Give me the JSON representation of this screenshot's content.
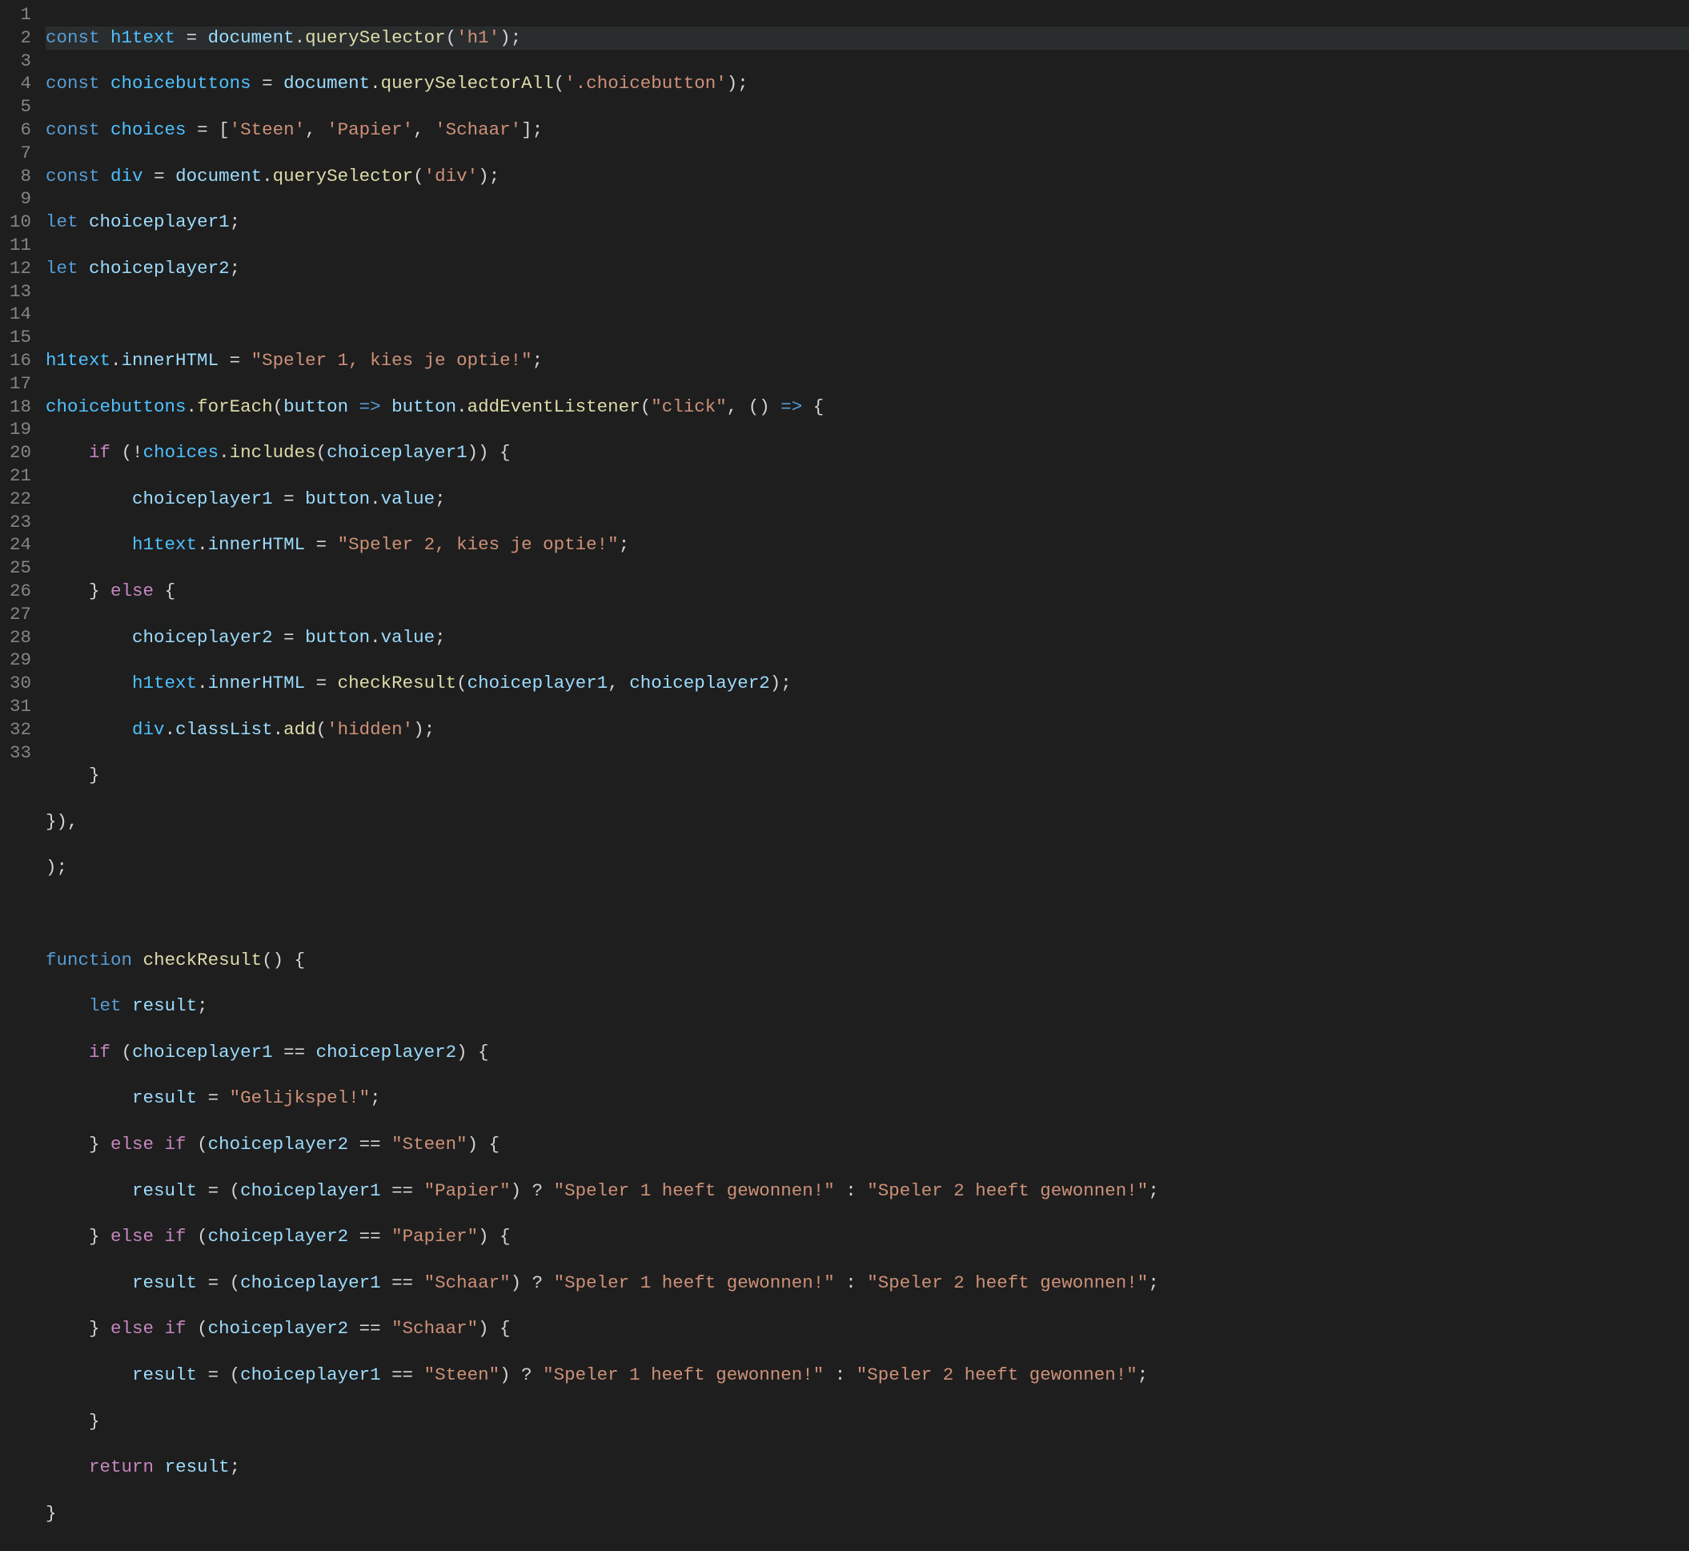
{
  "lineNumbers": [
    "1",
    "2",
    "3",
    "4",
    "5",
    "6",
    "7",
    "8",
    "9",
    "10",
    "11",
    "12",
    "13",
    "14",
    "15",
    "16",
    "17",
    "18",
    "19",
    "20",
    "21",
    "22",
    "23",
    "24",
    "25",
    "26",
    "27",
    "28",
    "29",
    "30",
    "31",
    "32",
    "33"
  ],
  "code": {
    "l1": {
      "kw": "const",
      "name": "h1text",
      "eq": " = ",
      "obj": "document",
      "dot": ".",
      "fn": "querySelector",
      "lp": "(",
      "str": "'h1'",
      "rp": ");"
    },
    "l2": {
      "kw": "const",
      "name": "choicebuttons",
      "eq": " = ",
      "obj": "document",
      "dot": ".",
      "fn": "querySelectorAll",
      "lp": "(",
      "str": "'.choicebutton'",
      "rp": ");"
    },
    "l3": {
      "kw": "const",
      "name": "choices",
      "eq": " = [",
      "s1": "'Steen'",
      "c1": ", ",
      "s2": "'Papier'",
      "c2": ", ",
      "s3": "'Schaar'",
      "end": "];"
    },
    "l4": {
      "kw": "const",
      "name": "div",
      "eq": " = ",
      "obj": "document",
      "dot": ".",
      "fn": "querySelector",
      "lp": "(",
      "str": "'div'",
      "rp": ");"
    },
    "l5": {
      "kw": "let",
      "name": "choiceplayer1",
      "end": ";"
    },
    "l6": {
      "kw": "let",
      "name": "choiceplayer2",
      "end": ";"
    },
    "l8": {
      "obj": "h1text",
      "dot": ".",
      "prop": "innerHTML",
      "eq": " = ",
      "str": "\"Speler 1, kies je optie!\"",
      "end": ";"
    },
    "l9": {
      "obj": "choicebuttons",
      "dot": ".",
      "fn": "forEach",
      "lp": "(",
      "param": "button",
      "arrow": " => ",
      "obj2": "button",
      "dot2": ".",
      "fn2": "addEventListener",
      "lp2": "(",
      "evt": "\"click\"",
      "c": ", () ",
      "arrow2": "=>",
      "brace": " {"
    },
    "l10": {
      "indent": "    ",
      "kw": "if",
      "lp": " (!",
      "obj": "choices",
      "dot": ".",
      "fn": "includes",
      "lp2": "(",
      "arg": "choiceplayer1",
      "rp": ")) {"
    },
    "l11": {
      "indent": "        ",
      "lhs": "choiceplayer1",
      "eq": " = ",
      "obj": "button",
      "dot": ".",
      "prop": "value",
      "end": ";"
    },
    "l12": {
      "indent": "        ",
      "obj": "h1text",
      "dot": ".",
      "prop": "innerHTML",
      "eq": " = ",
      "str": "\"Speler 2, kies je optie!\"",
      "end": ";"
    },
    "l13": {
      "indent": "    ",
      "close": "}",
      "kw": " else ",
      "open": "{"
    },
    "l14": {
      "indent": "        ",
      "lhs": "choiceplayer2",
      "eq": " = ",
      "obj": "button",
      "dot": ".",
      "prop": "value",
      "end": ";"
    },
    "l15": {
      "indent": "        ",
      "obj": "h1text",
      "dot": ".",
      "prop": "innerHTML",
      "eq": " = ",
      "fn": "checkResult",
      "lp": "(",
      "a1": "choiceplayer1",
      "c": ", ",
      "a2": "choiceplayer2",
      "rp": ");"
    },
    "l16": {
      "indent": "        ",
      "obj": "div",
      "dot": ".",
      "prop": "classList",
      "dot2": ".",
      "fn": "add",
      "lp": "(",
      "str": "'hidden'",
      "rp": ");"
    },
    "l17": {
      "indent": "    ",
      "close": "}"
    },
    "l18": {
      "text": "}),"
    },
    "l19": {
      "text": ");"
    },
    "l21": {
      "kw": "function",
      "name": "checkResult",
      "parens": "() {"
    },
    "l22": {
      "indent": "    ",
      "kw": "let",
      "name": "result",
      "end": ";"
    },
    "l23": {
      "indent": "    ",
      "kw": "if",
      "lp": " (",
      "a": "choiceplayer1",
      "op": " == ",
      "b": "choiceplayer2",
      "rp": ") {"
    },
    "l24": {
      "indent": "        ",
      "lhs": "result",
      "eq": " = ",
      "str": "\"Gelijkspel!\"",
      "end": ";"
    },
    "l25": {
      "indent": "    ",
      "close": "}",
      "kw": " else if",
      "lp": " (",
      "a": "choiceplayer2",
      "op": " == ",
      "str": "\"Steen\"",
      "rp": ") {"
    },
    "l26": {
      "indent": "        ",
      "lhs": "result",
      "eq": " = (",
      "a": "choiceplayer1",
      "op": " == ",
      "s1": "\"Papier\"",
      "q": ") ? ",
      "s2": "\"Speler 1 heeft gewonnen!\"",
      "colon": " : ",
      "s3": "\"Speler 2 heeft gewonnen!\"",
      "end": ";"
    },
    "l27": {
      "indent": "    ",
      "close": "}",
      "kw": " else if",
      "lp": " (",
      "a": "choiceplayer2",
      "op": " == ",
      "str": "\"Papier\"",
      "rp": ") {"
    },
    "l28": {
      "indent": "        ",
      "lhs": "result",
      "eq": " = (",
      "a": "choiceplayer1",
      "op": " == ",
      "s1": "\"Schaar\"",
      "q": ") ? ",
      "s2": "\"Speler 1 heeft gewonnen!\"",
      "colon": " : ",
      "s3": "\"Speler 2 heeft gewonnen!\"",
      "end": ";"
    },
    "l29": {
      "indent": "    ",
      "close": "}",
      "kw": " else if",
      "lp": " (",
      "a": "choiceplayer2",
      "op": " == ",
      "str": "\"Schaar\"",
      "rp": ") {"
    },
    "l30": {
      "indent": "        ",
      "lhs": "result",
      "eq": " = (",
      "a": "choiceplayer1",
      "op": " == ",
      "s1": "\"Steen\"",
      "q": ") ? ",
      "s2": "\"Speler 1 heeft gewonnen!\"",
      "colon": " : ",
      "s3": "\"Speler 2 heeft gewonnen!\"",
      "end": ";"
    },
    "l31": {
      "indent": "    ",
      "close": "}"
    },
    "l32": {
      "indent": "    ",
      "kw": "return",
      "name": "result",
      "end": ";"
    },
    "l33": {
      "close": "}"
    }
  }
}
